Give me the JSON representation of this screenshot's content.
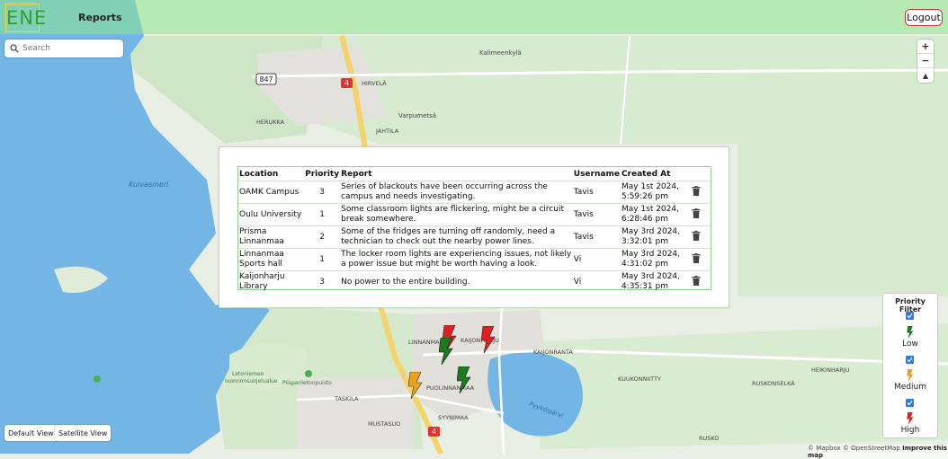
{
  "header": {
    "logo_text": "ENE",
    "reports_label": "Reports",
    "logout_label": "Logout"
  },
  "search": {
    "placeholder": "Search"
  },
  "map_labels": {
    "kalimeenkyla": "Kalimeenkylä",
    "hirvela": "HIRVELÄ",
    "varpumetsa": "Varpumetsä",
    "herukka": "HERUKKA",
    "jahtila": "JAHTILA",
    "kuivasmeri": "Kuivasmeri",
    "linnanmaa": "LINNANMAA",
    "kaijonharju": "KAIJONHARJU",
    "kaijonranta": "KAIJONRANTA",
    "puolinnanmaa": "PUOLINNANMAA",
    "letoniemen": "Letoniemen",
    "luonnonsuojelualue": "luonnonsuojelualue",
    "piispanletonpuisto": "Piispanletonpuisto",
    "taskila": "TASKILA",
    "mustasuo": "MUSTASUO",
    "syynimaa": "SYYNIMAA",
    "pyykosjarvi": "Pyykösjärvi",
    "kuukkonniitty": "KUUKONNIITTY",
    "ruskonselka": "RUSKONSELKÄ",
    "heikinharju": "HEIKINHARJU",
    "rusko": "RUSKO",
    "road_847": "847",
    "road_4_top": "4",
    "road_4_bottom": "4"
  },
  "reports_table": {
    "headers": [
      "Location",
      "Priority",
      "Report",
      "Username",
      "Created At"
    ],
    "rows": [
      {
        "location": "OAMK Campus",
        "priority": "3",
        "report": "Series of blackouts have been occurring across the campus and needs investigating.",
        "username": "Tavis",
        "created": "May 1st 2024, 5:59:26 pm"
      },
      {
        "location": "Oulu University",
        "priority": "1",
        "report": "Some classroom lights are flickering, might be a circuit break somewhere.",
        "username": "Tavis",
        "created": "May 1st 2024, 6:28:46 pm"
      },
      {
        "location": "Prisma Linnanmaa",
        "priority": "2",
        "report": "Some of the fridges are turning off randomly, need a technician to check out the nearby power lines.",
        "username": "Tavis",
        "created": "May 3rd 2024, 3:32:01 pm"
      },
      {
        "location": "Linnanmaa Sports hall",
        "priority": "1",
        "report": "The locker room lights are experiencing issues, not likely a power issue but might be worth having a look.",
        "username": "Vi",
        "created": "May 3rd 2024, 4:31:02 pm"
      },
      {
        "location": "Kaijonharju Library",
        "priority": "3",
        "report": "No power to the entire building.",
        "username": "Vi",
        "created": "May 3rd 2024, 4:35:31 pm"
      }
    ]
  },
  "view_buttons": {
    "default_label": "Default View",
    "satellite_label": "Satellite View"
  },
  "priority_filter": {
    "title": "Priority Filter",
    "low_label": "Low",
    "medium_label": "Medium",
    "high_label": "High",
    "low_checked": true,
    "medium_checked": true,
    "high_checked": true
  },
  "attribution": {
    "mapbox": "© Mapbox",
    "osm": "© OpenStreetMap",
    "improve": "Improve this map"
  },
  "colors": {
    "low": "#1f7a1f",
    "medium": "#f0a020",
    "high": "#e02020",
    "header_bar": "#8ce68c",
    "water": "#73b6e6"
  },
  "zoom_controls": {
    "zoom_in": "+",
    "zoom_out": "−",
    "compass": "▲"
  }
}
